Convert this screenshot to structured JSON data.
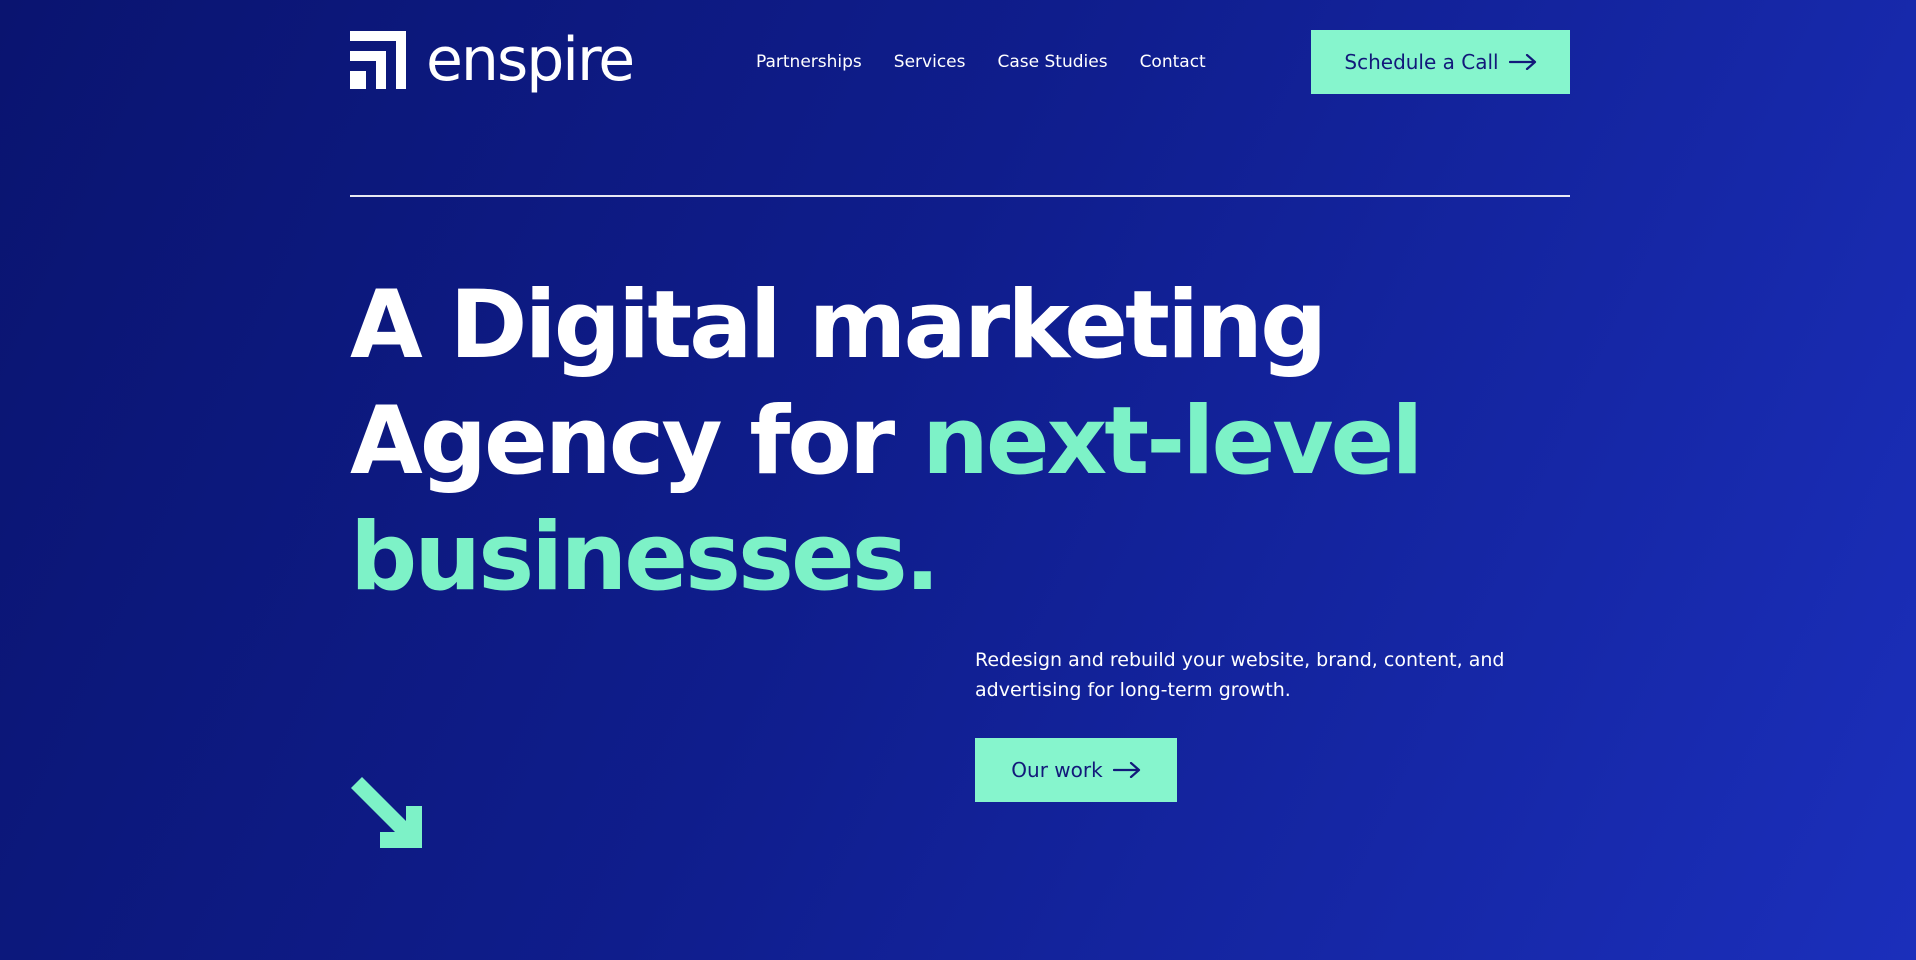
{
  "brand": {
    "name": "enspire",
    "logo_icon": "bracket-logo-icon"
  },
  "nav": {
    "items": [
      {
        "label": "Partnerships"
      },
      {
        "label": "Services"
      },
      {
        "label": "Case Studies"
      },
      {
        "label": "Contact"
      }
    ]
  },
  "header_cta": {
    "label": "Schedule a Call",
    "icon": "arrow-right-icon"
  },
  "hero": {
    "title_line1": "A Digital marketing",
    "title_line2_plain": "Agency for ",
    "title_line2_accent": "next-level",
    "title_line3_accent": "businesses.",
    "description": "Redesign and rebuild your website, brand, content, and advertising for long-term growth.",
    "cta_label": "Our work",
    "cta_icon": "arrow-right-icon",
    "decor_icon": "arrow-down-right-icon"
  },
  "colors": {
    "background_start": "#0a1470",
    "background_end": "#1b2fbb",
    "accent": "#7df2c7",
    "button_bg": "#86f5cd",
    "button_text": "#12197a",
    "text": "#ffffff"
  }
}
